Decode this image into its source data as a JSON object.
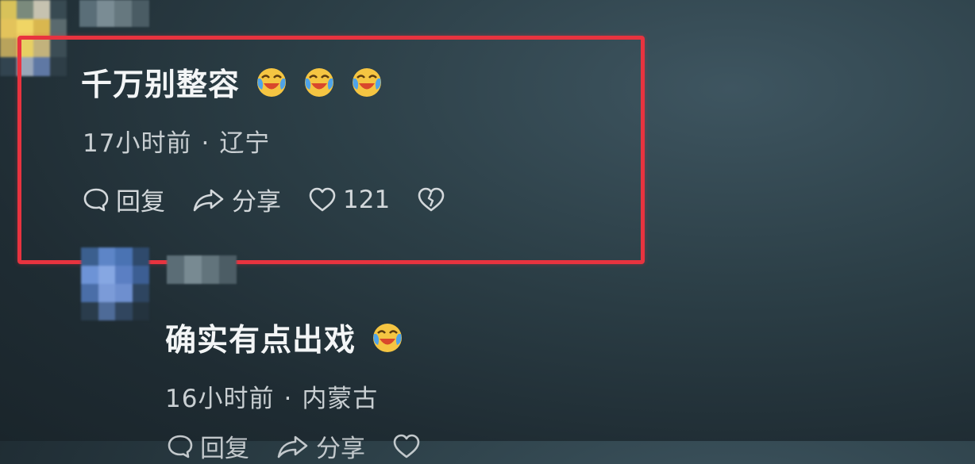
{
  "comments": [
    {
      "text": "千万别整容",
      "emoji": [
        "laugh-cry-emoji",
        "laugh-cry-emoji",
        "laugh-cry-emoji"
      ],
      "time": "17小时前",
      "location": "辽宁",
      "actions": {
        "reply": "回复",
        "share": "分享",
        "likes": "121"
      }
    },
    {
      "text": "确实有点出戏",
      "emoji": [
        "laugh-cry-emoji"
      ],
      "time": "16小时前",
      "location": "内蒙古",
      "actions": {
        "reply": "回复",
        "share": "分享"
      }
    }
  ],
  "separator": "·",
  "colors": {
    "highlight": "#e8333f",
    "background": "#2c3f47",
    "text": "#f3f5f6",
    "meta": "#c9cfd2"
  }
}
